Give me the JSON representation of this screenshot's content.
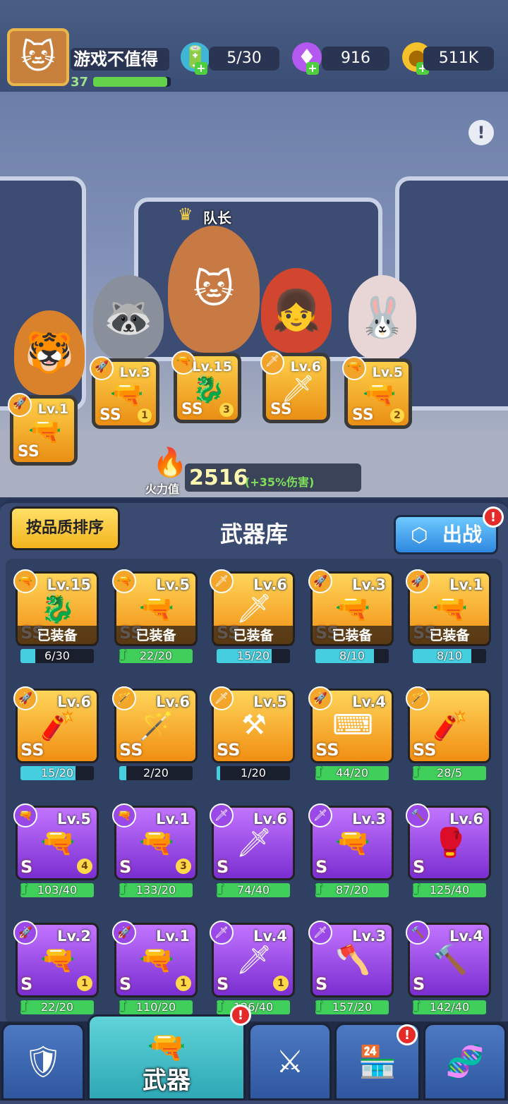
{
  "player": {
    "name": "游戏不值得",
    "level": "37",
    "xp_progress": 0.95
  },
  "resources": [
    {
      "icon": "energy-battery-icon",
      "value": "5/30"
    },
    {
      "icon": "gem-icon",
      "value": "916"
    },
    {
      "icon": "gold-coin-icon",
      "value": "511K"
    }
  ],
  "squad": {
    "captain_label": "队长",
    "members": [
      {
        "icon": "tiger-character",
        "weapon": {
          "level": "Lv.1",
          "grade": "SS",
          "stars": ""
        }
      },
      {
        "icon": "raccoon-character",
        "weapon": {
          "level": "Lv.3",
          "grade": "SS",
          "stars": "1"
        }
      },
      {
        "icon": "cat-captain-character",
        "weapon": {
          "level": "Lv.15",
          "grade": "SS",
          "stars": "3"
        }
      },
      {
        "icon": "red-hair-girl-character",
        "weapon": {
          "level": "Lv.6",
          "grade": "SS",
          "stars": ""
        }
      },
      {
        "icon": "rabbit-character",
        "weapon": {
          "level": "Lv.5",
          "grade": "SS",
          "stars": "2"
        }
      }
    ]
  },
  "firepower": {
    "label": "火力值",
    "value": "2516",
    "bonus": "(+35%伤害)"
  },
  "armory": {
    "sort_label": "按品质排序",
    "title": "武器库",
    "deploy_label": "出战",
    "badge": "!",
    "equipped_label": "已装备",
    "weapons": [
      {
        "rarity": "gold",
        "grade": "SS",
        "level": "Lv.15",
        "equipped": true,
        "progress": "6/30",
        "fill": 0.2,
        "stars": ""
      },
      {
        "rarity": "gold",
        "grade": "SS",
        "level": "Lv.5",
        "equipped": true,
        "progress": "22/20",
        "fill": 1,
        "stars": ""
      },
      {
        "rarity": "gold",
        "grade": "SS",
        "level": "Lv.6",
        "equipped": true,
        "progress": "15/20",
        "fill": 0.75,
        "stars": ""
      },
      {
        "rarity": "gold",
        "grade": "SS",
        "level": "Lv.3",
        "equipped": true,
        "progress": "8/10",
        "fill": 0.8,
        "stars": ""
      },
      {
        "rarity": "gold",
        "grade": "SS",
        "level": "Lv.1",
        "equipped": true,
        "progress": "8/10",
        "fill": 0.8,
        "stars": ""
      },
      {
        "rarity": "gold",
        "grade": "SS",
        "level": "Lv.6",
        "equipped": false,
        "progress": "15/20",
        "fill": 0.75,
        "stars": ""
      },
      {
        "rarity": "gold",
        "grade": "SS",
        "level": "Lv.6",
        "equipped": false,
        "progress": "2/20",
        "fill": 0.1,
        "stars": ""
      },
      {
        "rarity": "gold",
        "grade": "SS",
        "level": "Lv.5",
        "equipped": false,
        "progress": "1/20",
        "fill": 0.05,
        "stars": ""
      },
      {
        "rarity": "gold",
        "grade": "SS",
        "level": "Lv.4",
        "equipped": false,
        "progress": "44/20",
        "fill": 1,
        "stars": ""
      },
      {
        "rarity": "gold",
        "grade": "SS",
        "level": "",
        "equipped": false,
        "progress": "28/5",
        "fill": 1,
        "stars": ""
      },
      {
        "rarity": "purple",
        "grade": "S",
        "level": "Lv.5",
        "equipped": false,
        "progress": "103/40",
        "fill": 1,
        "stars": "4"
      },
      {
        "rarity": "purple",
        "grade": "S",
        "level": "Lv.1",
        "equipped": false,
        "progress": "133/20",
        "fill": 1,
        "stars": "3"
      },
      {
        "rarity": "purple",
        "grade": "S",
        "level": "Lv.6",
        "equipped": false,
        "progress": "74/40",
        "fill": 1,
        "stars": ""
      },
      {
        "rarity": "purple",
        "grade": "S",
        "level": "Lv.3",
        "equipped": false,
        "progress": "87/20",
        "fill": 1,
        "stars": ""
      },
      {
        "rarity": "purple",
        "grade": "S",
        "level": "Lv.6",
        "equipped": false,
        "progress": "125/40",
        "fill": 1,
        "stars": ""
      },
      {
        "rarity": "purple",
        "grade": "S",
        "level": "Lv.2",
        "equipped": false,
        "progress": "22/20",
        "fill": 1,
        "stars": "1"
      },
      {
        "rarity": "purple",
        "grade": "S",
        "level": "Lv.1",
        "equipped": false,
        "progress": "110/20",
        "fill": 1,
        "stars": "1"
      },
      {
        "rarity": "purple",
        "grade": "S",
        "level": "Lv.4",
        "equipped": false,
        "progress": "126/40",
        "fill": 1,
        "stars": "1"
      },
      {
        "rarity": "purple",
        "grade": "S",
        "level": "Lv.3",
        "equipped": false,
        "progress": "157/20",
        "fill": 1,
        "stars": ""
      },
      {
        "rarity": "purple",
        "grade": "S",
        "level": "Lv.4",
        "equipped": false,
        "progress": "142/40",
        "fill": 1,
        "stars": ""
      }
    ]
  },
  "nav": {
    "tabs": [
      {
        "icon": "armor-icon",
        "label": ""
      },
      {
        "icon": "pistol-icon",
        "label": "武器",
        "active": true,
        "badge": "!"
      },
      {
        "icon": "crossed-swords-icon",
        "label": ""
      },
      {
        "icon": "shop-icon",
        "label": "",
        "badge": "!"
      },
      {
        "icon": "dna-icon",
        "label": ""
      }
    ]
  },
  "colors": {
    "gold_card": "#f5a623",
    "purple_card": "#9b4be6",
    "progress_full": "#3fcf5a",
    "progress_partial": "#45cde0",
    "badge": "#e52a2a"
  }
}
